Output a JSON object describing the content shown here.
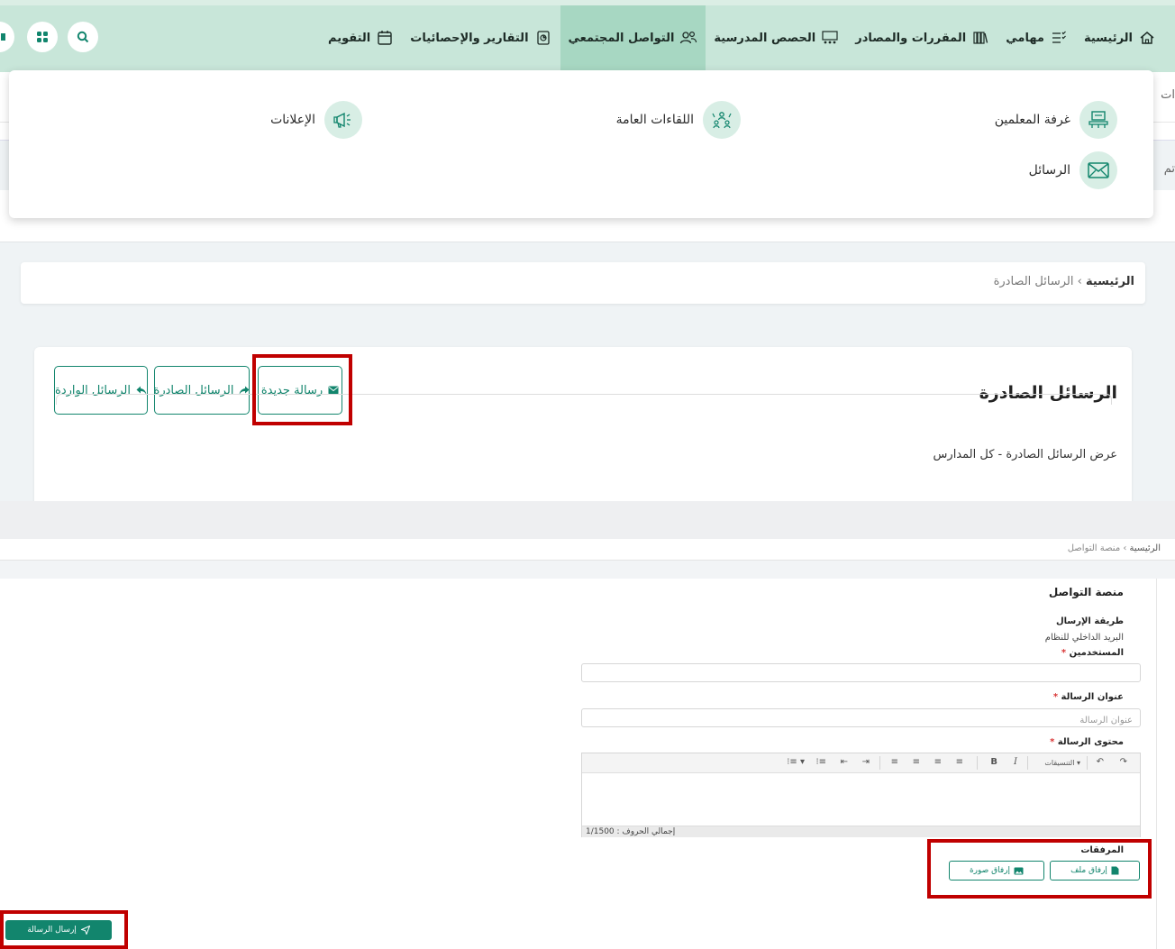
{
  "nav": {
    "items": [
      {
        "id": "home",
        "label": "الرئيسية",
        "icon": "home-icon",
        "active": false
      },
      {
        "id": "tasks",
        "label": "مهامي",
        "icon": "tasks-icon",
        "active": false
      },
      {
        "id": "courses",
        "label": "المقررات والمصادر",
        "icon": "library-icon",
        "active": false
      },
      {
        "id": "classes",
        "label": "الحصص المدرسية",
        "icon": "classroom-icon",
        "active": false
      },
      {
        "id": "community",
        "label": "التواصل المجتمعي",
        "icon": "people-icon",
        "active": true
      },
      {
        "id": "reports",
        "label": "التقارير والإحصائيات",
        "icon": "report-icon",
        "active": false
      },
      {
        "id": "calendar",
        "label": "التقويم",
        "icon": "calendar-icon",
        "active": false
      }
    ],
    "accent": "#a7d7c2"
  },
  "dropdown": {
    "teachers_room": "غرفة المعلمين",
    "public_meetings": "اللقاءات العامة",
    "announcements": "الإعلانات",
    "messages": "الرسائل"
  },
  "edge": {
    "top": "ات",
    "mid": "تم"
  },
  "outgoing": {
    "breadcrumb_home": "الرئيسية",
    "breadcrumb_sep": "›",
    "breadcrumb_current": "الرسائل الصادرة",
    "title": "الرسائل الصادرة",
    "subtitle": "عرض الرسائل الصادرة - كل المدارس",
    "new_message": "رسالة جديدة",
    "outbox": "الرسائل الصادرة",
    "inbox": "الرسائل الواردة"
  },
  "compose": {
    "breadcrumb_home": "الرئيسية",
    "breadcrumb_sep": "›",
    "breadcrumb_current": "منصة التواصل",
    "title": "منصة التواصل",
    "method_label": "طريقة الإرسال",
    "method_value": "البريد الداخلي للنظام",
    "users_label": "المستخدمين",
    "subject_label": "عنوان الرسالة",
    "subject_placeholder": "عنوان الرسالة",
    "content_label": "محتوى الرسالة",
    "format_label": "التنسيقات",
    "char_count": "إجمالي الحروف : 1/1500",
    "attachments_label": "المرفقات",
    "attach_file": "إرفاق ملف",
    "attach_image": "إرفاق صورة",
    "send": "إرسال الرسالة",
    "required_mark": "*"
  },
  "colors": {
    "primary": "#12856d",
    "highlight": "#c00000",
    "nav_bg": "#c8e6d9"
  }
}
